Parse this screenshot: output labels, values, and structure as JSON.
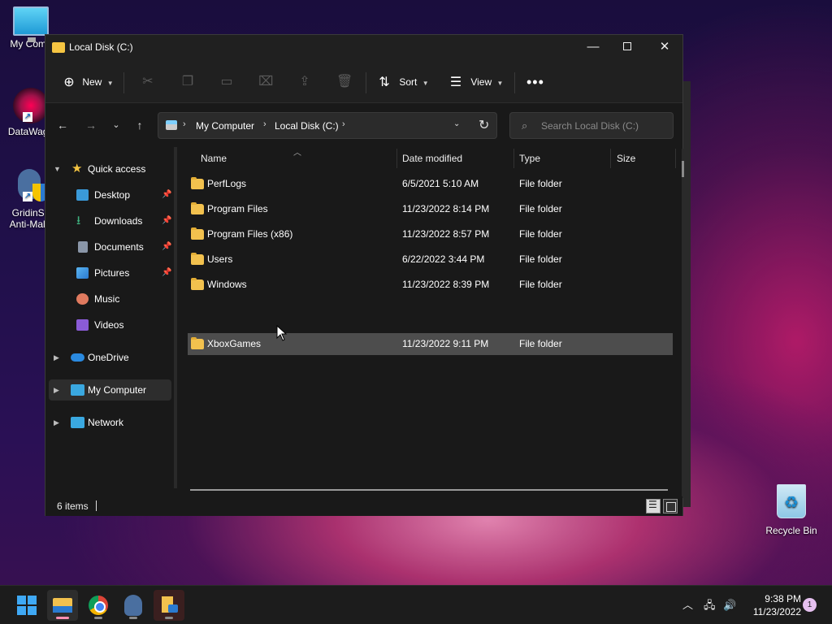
{
  "desktop": {
    "icons": [
      {
        "label": "My Comp"
      },
      {
        "label": "DataWago"
      },
      {
        "label": "GridinSo",
        "label2": "Anti-Malw"
      },
      {
        "label": "Recycle Bin"
      }
    ]
  },
  "window": {
    "title": "Local Disk (C:)",
    "controls": {
      "minimize": "—",
      "close": "✕"
    }
  },
  "toolbar": {
    "new_label": "New",
    "sort_label": "Sort",
    "view_label": "View",
    "more_label": "•••"
  },
  "navigation": {
    "breadcrumbs": [
      "My Computer",
      "Local Disk (C:)"
    ],
    "search_placeholder": "Search Local Disk (C:)"
  },
  "sidebar": {
    "items": [
      {
        "label": "Quick access"
      },
      {
        "label": "Desktop"
      },
      {
        "label": "Downloads"
      },
      {
        "label": "Documents"
      },
      {
        "label": "Pictures"
      },
      {
        "label": "Music"
      },
      {
        "label": "Videos"
      },
      {
        "label": "OneDrive"
      },
      {
        "label": "My Computer"
      },
      {
        "label": "Network"
      }
    ]
  },
  "file_list": {
    "columns": [
      "Name",
      "Date modified",
      "Type",
      "Size"
    ],
    "rows": [
      {
        "name": "PerfLogs",
        "date": "6/5/2021 5:10 AM",
        "type": "File folder"
      },
      {
        "name": "Program Files",
        "date": "11/23/2022 8:14 PM",
        "type": "File folder"
      },
      {
        "name": "Program Files (x86)",
        "date": "11/23/2022 8:57 PM",
        "type": "File folder"
      },
      {
        "name": "Users",
        "date": "6/22/2022 3:44 PM",
        "type": "File folder"
      },
      {
        "name": "Windows",
        "date": "11/23/2022 8:39 PM",
        "type": "File folder"
      },
      {
        "name": "XboxGames",
        "date": "11/23/2022 9:11 PM",
        "type": "File folder"
      }
    ]
  },
  "statusbar": {
    "item_count": "6 items"
  },
  "taskbar": {
    "time": "9:38 PM",
    "date": "11/23/2022",
    "notification_count": "1"
  },
  "colors": {
    "accent": "#3fa9f5",
    "window_bg": "#191919",
    "folder": "#f2c14e"
  }
}
